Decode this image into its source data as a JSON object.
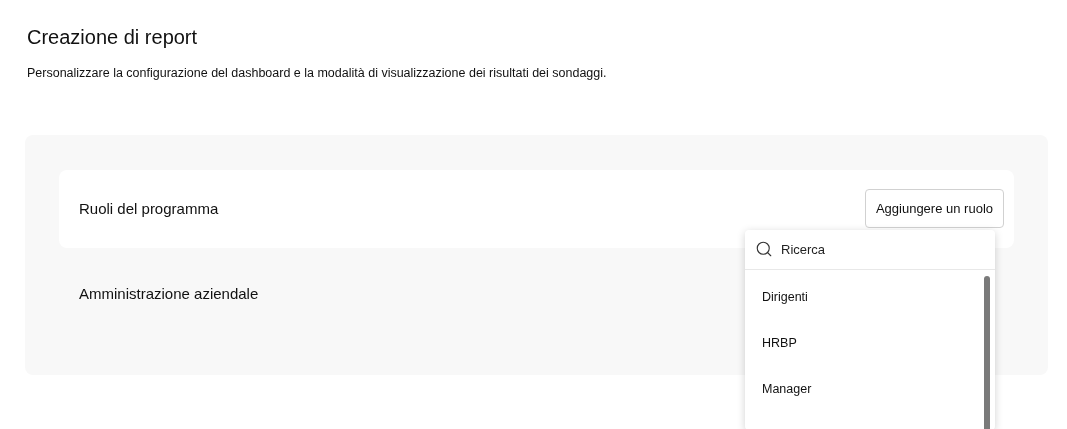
{
  "page": {
    "title": "Creazione di report",
    "description": "Personalizzare la configurazione del dashboard e la modalità di visualizzazione dei risultati dei sondaggi."
  },
  "sections": [
    {
      "label": "Ruoli del programma",
      "button": "Aggiungere un ruolo"
    },
    {
      "label": "Amministrazione aziendale"
    }
  ],
  "dropdown": {
    "search": {
      "placeholder": "Ricerca"
    },
    "options": [
      "Dirigenti",
      "HRBP",
      "Manager"
    ]
  }
}
